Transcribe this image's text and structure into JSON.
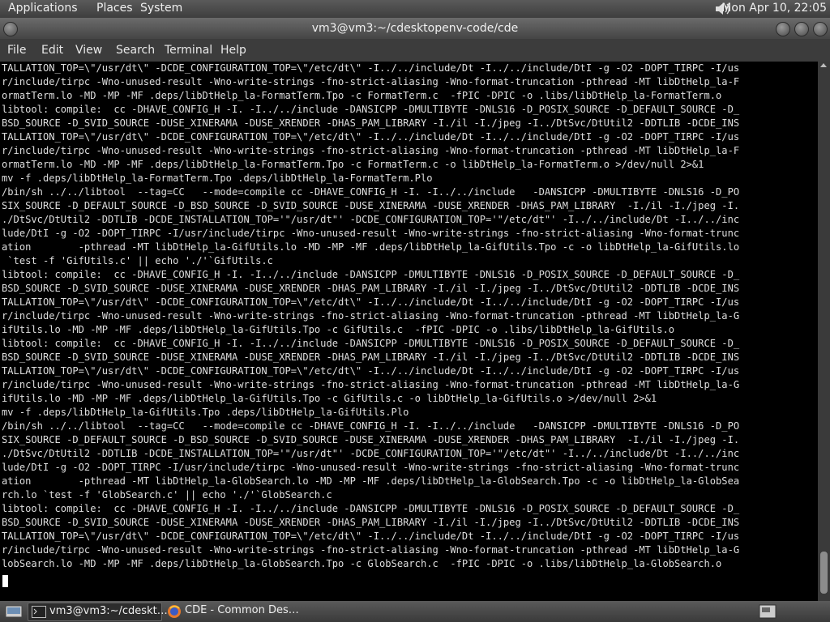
{
  "top_panel": {
    "menus": [
      "Applications",
      "Places",
      "System"
    ],
    "clock": "Mon Apr 10, 22:05"
  },
  "window": {
    "title": "vm3@vm3:~/cdesktopenv-code/cde",
    "menu": [
      "File",
      "Edit",
      "View",
      "Search",
      "Terminal",
      "Help"
    ]
  },
  "terminal": {
    "lines": [
      "TALLATION_TOP=\\\"/usr/dt\\\" -DCDE_CONFIGURATION_TOP=\\\"/etc/dt\\\" -I../../include/Dt -I../../include/DtI -g -O2 -DOPT_TIRPC -I/us",
      "r/include/tirpc -Wno-unused-result -Wno-write-strings -fno-strict-aliasing -Wno-format-truncation -pthread -MT libDtHelp_la-F",
      "ormatTerm.lo -MD -MP -MF .deps/libDtHelp_la-FormatTerm.Tpo -c FormatTerm.c  -fPIC -DPIC -o .libs/libDtHelp_la-FormatTerm.o",
      "libtool: compile:  cc -DHAVE_CONFIG_H -I. -I../../include -DANSICPP -DMULTIBYTE -DNLS16 -D_POSIX_SOURCE -D_DEFAULT_SOURCE -D_",
      "BSD_SOURCE -D_SVID_SOURCE -DUSE_XINERAMA -DUSE_XRENDER -DHAS_PAM_LIBRARY -I./il -I./jpeg -I../DtSvc/DtUtil2 -DDTLIB -DCDE_INS",
      "TALLATION_TOP=\\\"/usr/dt\\\" -DCDE_CONFIGURATION_TOP=\\\"/etc/dt\\\" -I../../include/Dt -I../../include/DtI -g -O2 -DOPT_TIRPC -I/us",
      "r/include/tirpc -Wno-unused-result -Wno-write-strings -fno-strict-aliasing -Wno-format-truncation -pthread -MT libDtHelp_la-F",
      "ormatTerm.lo -MD -MP -MF .deps/libDtHelp_la-FormatTerm.Tpo -c FormatTerm.c -o libDtHelp_la-FormatTerm.o >/dev/null 2>&1",
      "mv -f .deps/libDtHelp_la-FormatTerm.Tpo .deps/libDtHelp_la-FormatTerm.Plo",
      "/bin/sh ../../libtool  --tag=CC   --mode=compile cc -DHAVE_CONFIG_H -I. -I../../include   -DANSICPP -DMULTIBYTE -DNLS16 -D_PO",
      "SIX_SOURCE -D_DEFAULT_SOURCE -D_BSD_SOURCE -D_SVID_SOURCE -DUSE_XINERAMA -DUSE_XRENDER -DHAS_PAM_LIBRARY  -I./il -I./jpeg -I.",
      "./DtSvc/DtUtil2 -DDTLIB -DCDE_INSTALLATION_TOP='\"/usr/dt\"' -DCDE_CONFIGURATION_TOP='\"/etc/dt\"' -I../../include/Dt -I../../inc",
      "lude/DtI -g -O2 -DOPT_TIRPC -I/usr/include/tirpc -Wno-unused-result -Wno-write-strings -fno-strict-aliasing -Wno-format-trunc",
      "ation        -pthread -MT libDtHelp_la-GifUtils.lo -MD -MP -MF .deps/libDtHelp_la-GifUtils.Tpo -c -o libDtHelp_la-GifUtils.lo",
      " `test -f 'GifUtils.c' || echo './'`GifUtils.c",
      "libtool: compile:  cc -DHAVE_CONFIG_H -I. -I../../include -DANSICPP -DMULTIBYTE -DNLS16 -D_POSIX_SOURCE -D_DEFAULT_SOURCE -D_",
      "BSD_SOURCE -D_SVID_SOURCE -DUSE_XINERAMA -DUSE_XRENDER -DHAS_PAM_LIBRARY -I./il -I./jpeg -I../DtSvc/DtUtil2 -DDTLIB -DCDE_INS",
      "TALLATION_TOP=\\\"/usr/dt\\\" -DCDE_CONFIGURATION_TOP=\\\"/etc/dt\\\" -I../../include/Dt -I../../include/DtI -g -O2 -DOPT_TIRPC -I/us",
      "r/include/tirpc -Wno-unused-result -Wno-write-strings -fno-strict-aliasing -Wno-format-truncation -pthread -MT libDtHelp_la-G",
      "ifUtils.lo -MD -MP -MF .deps/libDtHelp_la-GifUtils.Tpo -c GifUtils.c  -fPIC -DPIC -o .libs/libDtHelp_la-GifUtils.o",
      "libtool: compile:  cc -DHAVE_CONFIG_H -I. -I../../include -DANSICPP -DMULTIBYTE -DNLS16 -D_POSIX_SOURCE -D_DEFAULT_SOURCE -D_",
      "BSD_SOURCE -D_SVID_SOURCE -DUSE_XINERAMA -DUSE_XRENDER -DHAS_PAM_LIBRARY -I./il -I./jpeg -I../DtSvc/DtUtil2 -DDTLIB -DCDE_INS",
      "TALLATION_TOP=\\\"/usr/dt\\\" -DCDE_CONFIGURATION_TOP=\\\"/etc/dt\\\" -I../../include/Dt -I../../include/DtI -g -O2 -DOPT_TIRPC -I/us",
      "r/include/tirpc -Wno-unused-result -Wno-write-strings -fno-strict-aliasing -Wno-format-truncation -pthread -MT libDtHelp_la-G",
      "ifUtils.lo -MD -MP -MF .deps/libDtHelp_la-GifUtils.Tpo -c GifUtils.c -o libDtHelp_la-GifUtils.o >/dev/null 2>&1",
      "mv -f .deps/libDtHelp_la-GifUtils.Tpo .deps/libDtHelp_la-GifUtils.Plo",
      "/bin/sh ../../libtool  --tag=CC   --mode=compile cc -DHAVE_CONFIG_H -I. -I../../include   -DANSICPP -DMULTIBYTE -DNLS16 -D_PO",
      "SIX_SOURCE -D_DEFAULT_SOURCE -D_BSD_SOURCE -D_SVID_SOURCE -DUSE_XINERAMA -DUSE_XRENDER -DHAS_PAM_LIBRARY  -I./il -I./jpeg -I.",
      "./DtSvc/DtUtil2 -DDTLIB -DCDE_INSTALLATION_TOP='\"/usr/dt\"' -DCDE_CONFIGURATION_TOP='\"/etc/dt\"' -I../../include/Dt -I../../inc",
      "lude/DtI -g -O2 -DOPT_TIRPC -I/usr/include/tirpc -Wno-unused-result -Wno-write-strings -fno-strict-aliasing -Wno-format-trunc",
      "ation        -pthread -MT libDtHelp_la-GlobSearch.lo -MD -MP -MF .deps/libDtHelp_la-GlobSearch.Tpo -c -o libDtHelp_la-GlobSea",
      "rch.lo `test -f 'GlobSearch.c' || echo './'`GlobSearch.c",
      "libtool: compile:  cc -DHAVE_CONFIG_H -I. -I../../include -DANSICPP -DMULTIBYTE -DNLS16 -D_POSIX_SOURCE -D_DEFAULT_SOURCE -D_",
      "BSD_SOURCE -D_SVID_SOURCE -DUSE_XINERAMA -DUSE_XRENDER -DHAS_PAM_LIBRARY -I./il -I./jpeg -I../DtSvc/DtUtil2 -DDTLIB -DCDE_INS",
      "TALLATION_TOP=\\\"/usr/dt\\\" -DCDE_CONFIGURATION_TOP=\\\"/etc/dt\\\" -I../../include/Dt -I../../include/DtI -g -O2 -DOPT_TIRPC -I/us",
      "r/include/tirpc -Wno-unused-result -Wno-write-strings -fno-strict-aliasing -Wno-format-truncation -pthread -MT libDtHelp_la-G",
      "lobSearch.lo -MD -MP -MF .deps/libDtHelp_la-GlobSearch.Tpo -c GlobSearch.c  -fPIC -DPIC -o .libs/libDtHelp_la-GlobSearch.o"
    ]
  },
  "taskbar": {
    "tasks": [
      {
        "label": "vm3@vm3:~/cdeskt…",
        "icon": "terminal-icon"
      },
      {
        "label": "CDE - Common Des…",
        "icon": "firefox-icon"
      }
    ]
  }
}
